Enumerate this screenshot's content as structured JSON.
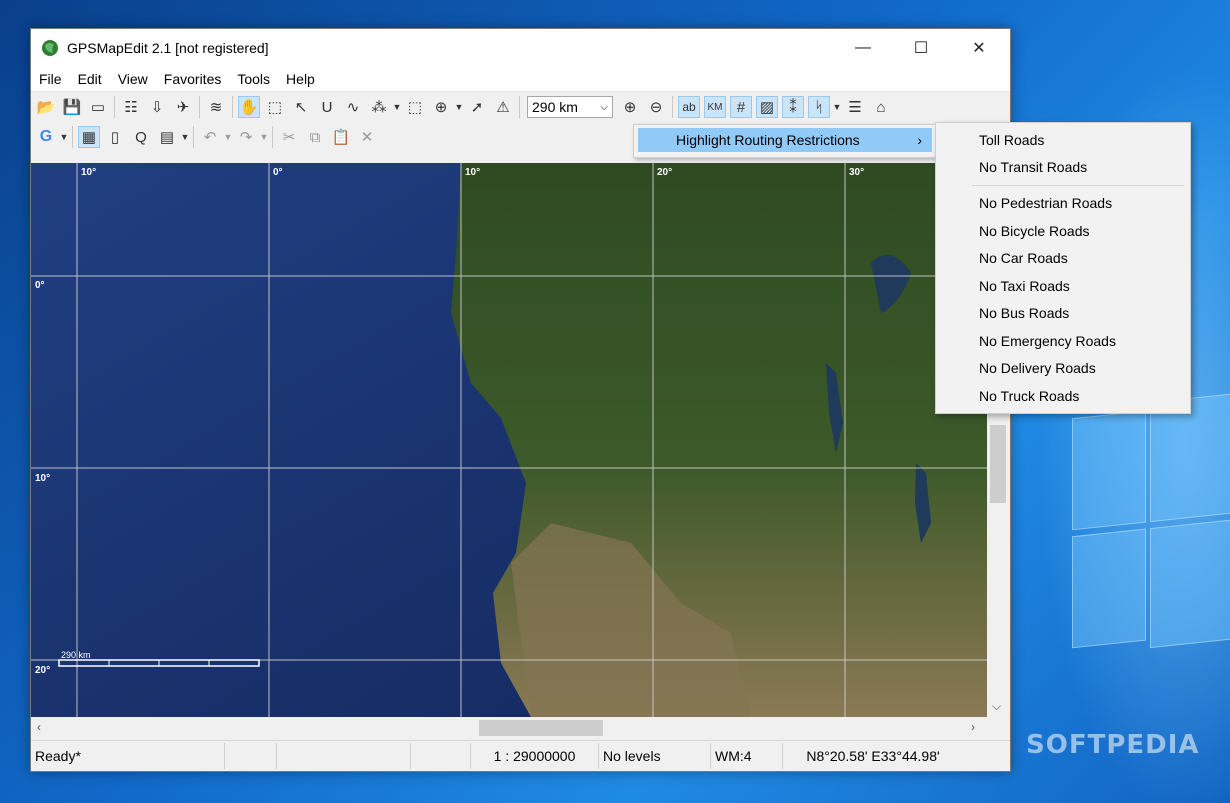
{
  "window": {
    "title": "GPSMapEdit 2.1 [not registered]",
    "controls": {
      "minimize": "—",
      "maximize": "☐",
      "close": "✕"
    }
  },
  "menu": [
    "File",
    "Edit",
    "View",
    "Favorites",
    "Tools",
    "Help"
  ],
  "toolbar": {
    "scale_value": "290 km",
    "text_ab": "ab",
    "text_km": "KM"
  },
  "map": {
    "grid_labels_top": [
      "10°",
      "0°",
      "10°",
      "20°",
      "30°"
    ],
    "grid_labels_left": [
      "0°",
      "10°",
      "20°"
    ],
    "scale_bar_label": "290 km"
  },
  "context_menu": {
    "item": "Highlight Routing Restrictions",
    "arrow": "›",
    "submenu": [
      "Toll Roads",
      "No Transit Roads",
      "No Pedestrian Roads",
      "No Bicycle Roads",
      "No Car Roads",
      "No Taxi Roads",
      "No Bus Roads",
      "No Emergency Roads",
      "No Delivery Roads",
      "No Truck Roads"
    ]
  },
  "statusbar": {
    "status": "Ready*",
    "scale": "1 : 29000000",
    "levels": "No levels",
    "wm": "WM:4",
    "coords": "N8°20.58' E33°44.98'"
  },
  "watermark": "SOFTPEDIA",
  "colors": {
    "menu_highlight": "#91c9f7",
    "ocean": "#1d3b7a",
    "land": "#3d5a2a",
    "desert": "#8a7a55"
  }
}
